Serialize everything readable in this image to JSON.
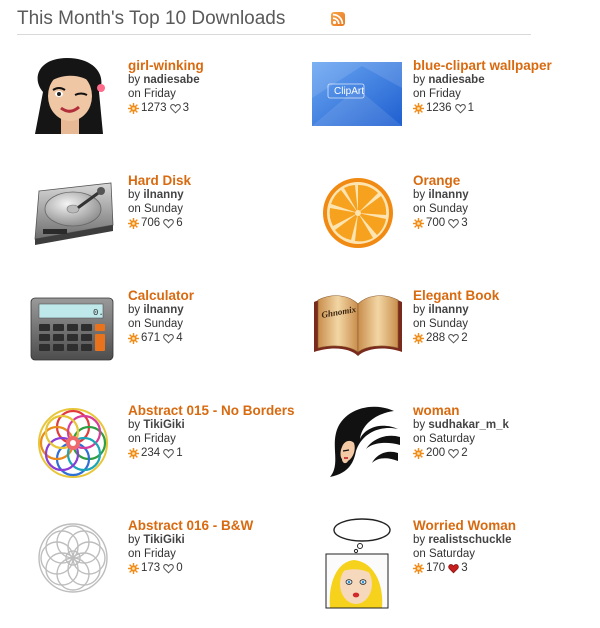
{
  "header": {
    "title": "This Month's Top 10 Downloads",
    "feed_icon": "rss-feed-icon"
  },
  "colors": {
    "title_link": "#d86a10",
    "heart_liked": "#c81e1e",
    "heart_empty": "#555555"
  },
  "items": [
    {
      "title": "girl-winking",
      "by": "by",
      "author": "nadiesabe",
      "on": "on Friday",
      "downloads": "1273",
      "favorites": "3",
      "liked": false,
      "thumb_icon": "girl-winking-thumbnail"
    },
    {
      "title": "blue-clipart wallpaper",
      "by": "by",
      "author": "nadiesabe",
      "on": "on Friday",
      "downloads": "1236",
      "favorites": "1",
      "liked": false,
      "thumb_icon": "blue-wallpaper-thumbnail",
      "thumb_text": "ClipArt"
    },
    {
      "title": "Hard Disk",
      "by": "by",
      "author": "ilnanny",
      "on": "on Sunday",
      "downloads": "706",
      "favorites": "6",
      "liked": false,
      "thumb_icon": "hard-disk-thumbnail"
    },
    {
      "title": "Orange",
      "by": "by",
      "author": "ilnanny",
      "on": "on Sunday",
      "downloads": "700",
      "favorites": "3",
      "liked": false,
      "thumb_icon": "orange-slice-thumbnail"
    },
    {
      "title": "Calculator",
      "by": "by",
      "author": "ilnanny",
      "on": "on Sunday",
      "downloads": "671",
      "favorites": "4",
      "liked": false,
      "thumb_icon": "calculator-thumbnail",
      "thumb_text": "0."
    },
    {
      "title": "Elegant Book",
      "by": "by",
      "author": "ilnanny",
      "on": "on Sunday",
      "downloads": "288",
      "favorites": "2",
      "liked": false,
      "thumb_icon": "open-book-thumbnail",
      "thumb_text": "Ghnomix"
    },
    {
      "title": "Abstract 015 - No Borders",
      "by": "by",
      "author": "TikiGiki",
      "on": "on Friday",
      "downloads": "234",
      "favorites": "1",
      "liked": false,
      "thumb_icon": "colorful-mandala-thumbnail"
    },
    {
      "title": "woman",
      "by": "by",
      "author": "sudhakar_m_k",
      "on": "on Saturday",
      "downloads": "200",
      "favorites": "2",
      "liked": false,
      "thumb_icon": "woman-profile-thumbnail"
    },
    {
      "title": "Abstract 016 - B&W",
      "by": "by",
      "author": "TikiGiki",
      "on": "on Friday",
      "downloads": "173",
      "favorites": "0",
      "liked": false,
      "thumb_icon": "bw-mandala-thumbnail"
    },
    {
      "title": "Worried Woman",
      "by": "by",
      "author": "realistschuckle",
      "on": "on Saturday",
      "downloads": "170",
      "favorites": "3",
      "liked": true,
      "thumb_icon": "worried-woman-thumbnail"
    }
  ]
}
